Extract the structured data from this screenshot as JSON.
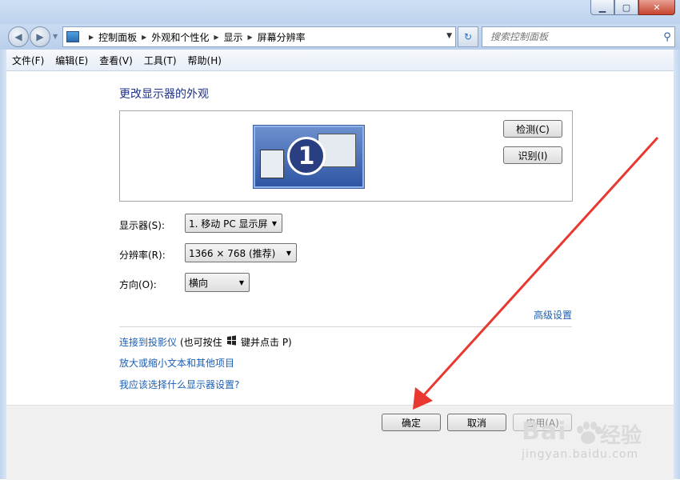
{
  "window": {
    "minimize_icon": "minimize-icon",
    "maximize_icon": "maximize-icon",
    "close_icon": "close-icon"
  },
  "address_bar": {
    "breadcrumbs": [
      "控制面板",
      "外观和个性化",
      "显示",
      "屏幕分辨率"
    ],
    "search_placeholder": "搜索控制面板"
  },
  "menu": [
    "文件(F)",
    "编辑(E)",
    "查看(V)",
    "工具(T)",
    "帮助(H)"
  ],
  "main": {
    "heading": "更改显示器的外观",
    "monitor_number": "1",
    "detect_label": "检测(C)",
    "identify_label": "识别(I)",
    "display_label": "显示器(S):",
    "display_value": "1. 移动 PC 显示屏",
    "resolution_label": "分辨率(R):",
    "resolution_value": "1366 × 768 (推荐)",
    "orientation_label": "方向(O):",
    "orientation_value": "横向",
    "advanced_link": "高级设置",
    "projector_link": "连接到投影仪",
    "projector_hint_before": "(也可按住",
    "projector_hint_after": "键并点击 P)",
    "text_size_link": "放大或缩小文本和其他项目",
    "which_settings_link": "我应该选择什么显示器设置?"
  },
  "footer": {
    "ok_label": "确定",
    "cancel_label": "取消",
    "apply_label": "应用(A)"
  },
  "watermark": {
    "logo": "Bai",
    "logo_cn": "经验",
    "url": "jingyan.baidu.com"
  },
  "colors": {
    "heading": "#1e3287",
    "link": "#1a5fb4",
    "annotation_arrow": "#e8382f"
  }
}
